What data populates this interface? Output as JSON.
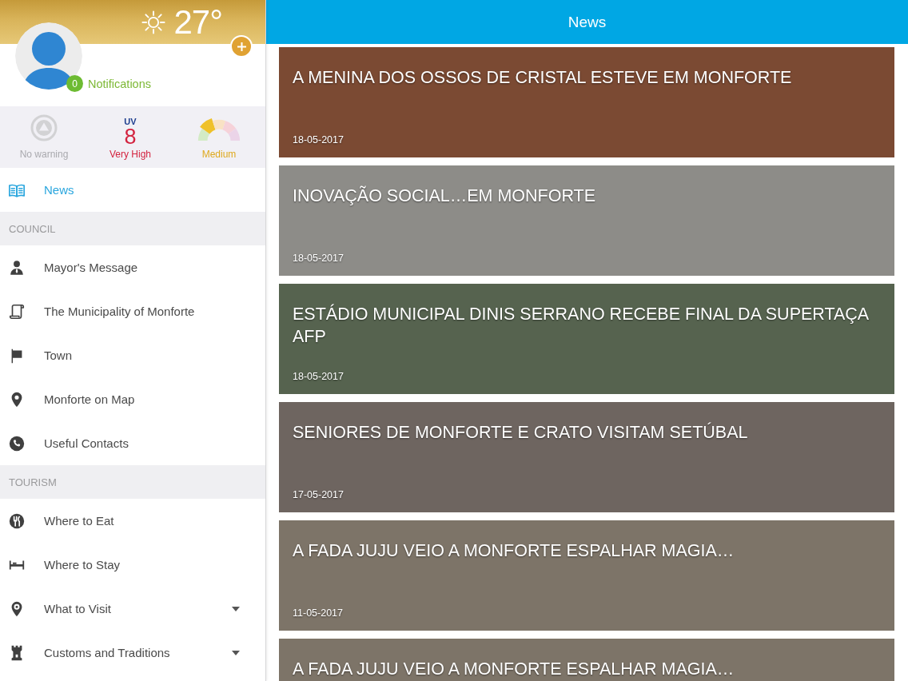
{
  "sidebar": {
    "weather": {
      "temperature": "27°"
    },
    "profile": {
      "notification_count": "0",
      "notifications_label": "Notifications"
    },
    "conditions": [
      {
        "kind": "warning",
        "active": false,
        "label": "No warning"
      },
      {
        "kind": "uv",
        "caption": "UV",
        "value": "8",
        "label": "Very High"
      },
      {
        "kind": "gauge",
        "label": "Medium"
      }
    ],
    "menu": [
      {
        "items": [
          {
            "kind": "link",
            "label": "News",
            "selected": true
          }
        ]
      },
      {
        "title": "COUNCIL",
        "items": [
          {
            "kind": "link",
            "label": "Mayor's Message",
            "selected": false
          },
          {
            "kind": "link",
            "label": "The Municipality of Monforte",
            "selected": false
          },
          {
            "kind": "link",
            "label": "Town",
            "selected": false
          },
          {
            "kind": "link",
            "label": "Monforte on Map",
            "selected": false
          },
          {
            "kind": "link",
            "label": "Useful Contacts",
            "selected": false
          }
        ]
      },
      {
        "title": "TOURISM",
        "items": [
          {
            "kind": "link",
            "label": "Where to Eat",
            "selected": false
          },
          {
            "kind": "link",
            "label": "Where to Stay",
            "selected": false
          },
          {
            "kind": "group",
            "label": "What to Visit",
            "selected": false
          },
          {
            "kind": "group",
            "label": "Customs and Traditions",
            "selected": false
          }
        ]
      }
    ]
  },
  "header": {
    "title": "News"
  },
  "news": [
    {
      "title": "A MENINA DOS OSSOS DE CRISTAL ESTEVE EM MONFORTE",
      "date": "18-05-2017"
    },
    {
      "title": "INOVAÇÃO SOCIAL…EM MONFORTE",
      "date": "18-05-2017"
    },
    {
      "title": "ESTÁDIO MUNICIPAL DINIS SERRANO RECEBE FINAL DA SUPERTAÇA AFP",
      "date": "18-05-2017"
    },
    {
      "title": "SENIORES DE MONFORTE E CRATO VISITAM SETÚBAL",
      "date": "17-05-2017"
    },
    {
      "title": "A FADA JUJU VEIO A MONFORTE ESPALHAR MAGIA…",
      "date": "11-05-2017"
    },
    {
      "title": "A FADA JUJU VEIO A MONFORTE ESPALHAR MAGIA…"
    }
  ]
}
